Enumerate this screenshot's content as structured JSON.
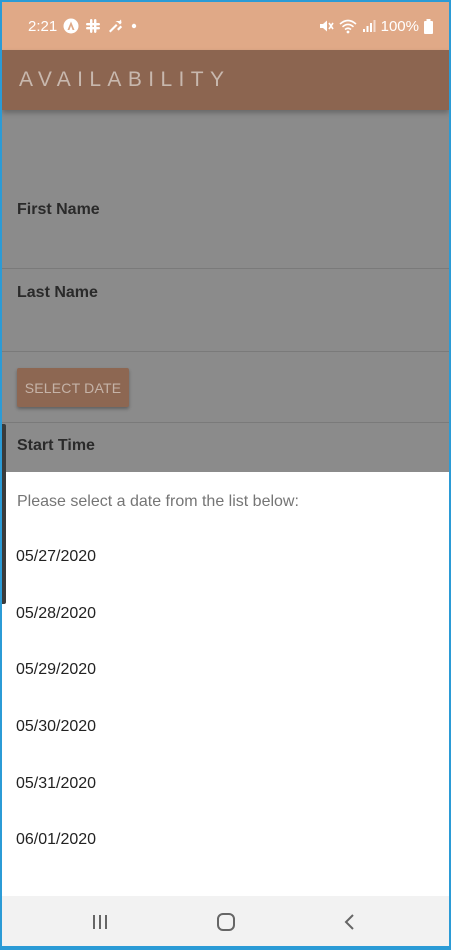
{
  "status_bar": {
    "time": "2:21",
    "battery": "100%",
    "icons": [
      "android-auto-icon",
      "slack-icon",
      "tools-icon",
      "dot-icon",
      "mute-icon",
      "wifi-icon",
      "signal-icon",
      "battery-icon"
    ]
  },
  "app_bar": {
    "title": "AVAILABILITY"
  },
  "form": {
    "first_name_label": "First Name",
    "last_name_label": "Last Name",
    "select_date_label": "SELECT DATE",
    "start_time_label": "Start Time"
  },
  "sheet": {
    "prompt": "Please select a date from the list below:",
    "dates": [
      "05/27/2020",
      "05/28/2020",
      "05/29/2020",
      "05/30/2020",
      "05/31/2020",
      "06/01/2020"
    ]
  },
  "nav_bar": {
    "icons": [
      "recents-icon",
      "home-icon",
      "back-icon"
    ]
  },
  "colors": {
    "status_bar": "#e0a987",
    "app_bar": "#8c6550",
    "scrim": "#8b8b8b",
    "sheet": "#ffffff",
    "frame": "#2b9bd6"
  }
}
